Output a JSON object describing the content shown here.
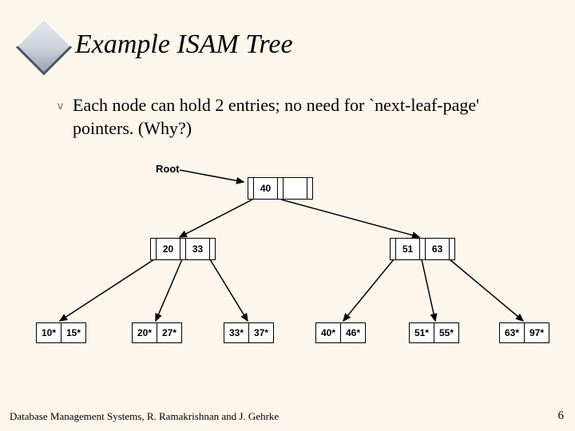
{
  "title": "Example ISAM Tree",
  "bullet_marker": "v",
  "bullet_text": "Each node can hold 2 entries; no need for `next-leaf-page' pointers.  (Why?)",
  "root_label": "Root",
  "root_node": {
    "keys": [
      "40",
      ""
    ]
  },
  "internal_nodes": [
    {
      "keys": [
        "20",
        "33"
      ]
    },
    {
      "keys": [
        "51",
        "63"
      ]
    }
  ],
  "leaf_nodes": [
    {
      "cells": [
        "10*",
        "15*"
      ]
    },
    {
      "cells": [
        "20*",
        "27*"
      ]
    },
    {
      "cells": [
        "33*",
        "37*"
      ]
    },
    {
      "cells": [
        "40*",
        "46*"
      ]
    },
    {
      "cells": [
        "51*",
        "55*"
      ]
    },
    {
      "cells": [
        "63*",
        "97*"
      ]
    }
  ],
  "footer": "Database Management Systems, R. Ramakrishnan and J. Gehrke",
  "page_number": "6",
  "chart_data": {
    "type": "diagram",
    "structure": "ISAM index tree",
    "fanout": "each node holds 2 entries",
    "root": {
      "keys": [
        40
      ]
    },
    "level1": [
      {
        "keys": [
          20,
          33
        ]
      },
      {
        "keys": [
          51,
          63
        ]
      }
    ],
    "leaves": [
      [
        10,
        15
      ],
      [
        20,
        27
      ],
      [
        33,
        37
      ],
      [
        40,
        46
      ],
      [
        51,
        55
      ],
      [
        63,
        97
      ]
    ]
  }
}
